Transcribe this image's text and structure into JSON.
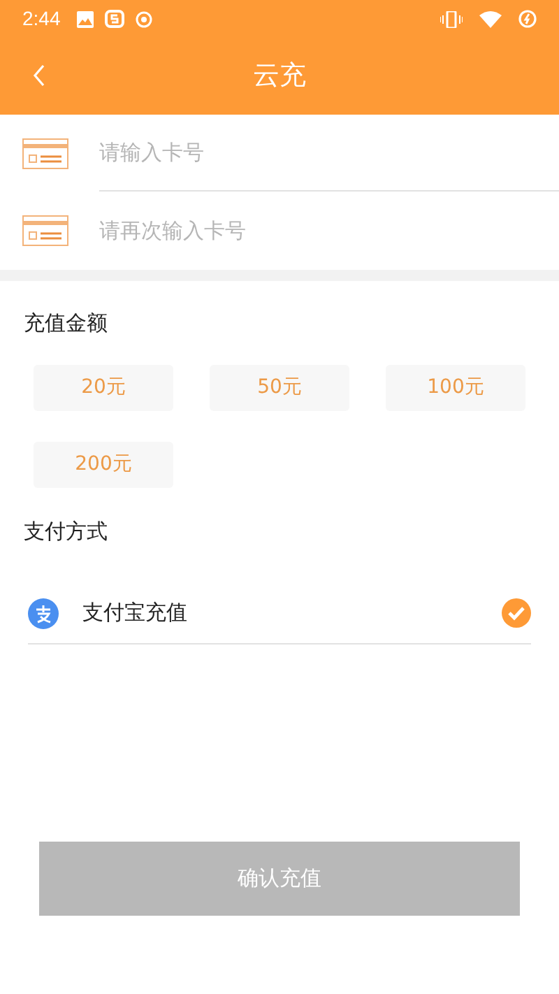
{
  "status_bar": {
    "time": "2:44"
  },
  "header": {
    "title": "云充"
  },
  "card_fields": [
    {
      "placeholder": "请输入卡号"
    },
    {
      "placeholder": "请再次输入卡号"
    }
  ],
  "amount_section": {
    "title": "充值金额",
    "options": [
      {
        "label": "20元",
        "selected": false
      },
      {
        "label": "50元",
        "selected": false
      },
      {
        "label": "100元",
        "selected": false
      },
      {
        "label": "200元",
        "selected": false
      }
    ]
  },
  "payment_section": {
    "title": "支付方式",
    "methods": [
      {
        "label": "支付宝充值",
        "checked": true
      }
    ]
  },
  "confirm_button": {
    "label": "确认充值",
    "disabled": true
  }
}
